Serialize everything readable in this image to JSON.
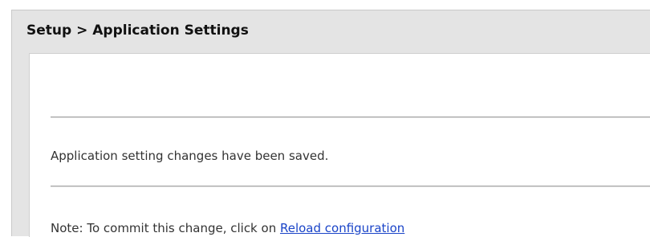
{
  "panel": {
    "title": "Setup > Application Settings"
  },
  "status": {
    "saved_message": "Application setting changes have been saved."
  },
  "note": {
    "prefix": "Note: To commit this change, click on ",
    "link_label": "Reload configuration"
  },
  "colors": {
    "frame_bg": "#e4e4e4",
    "content_bg": "#ffffff",
    "link": "#1a44c8"
  }
}
